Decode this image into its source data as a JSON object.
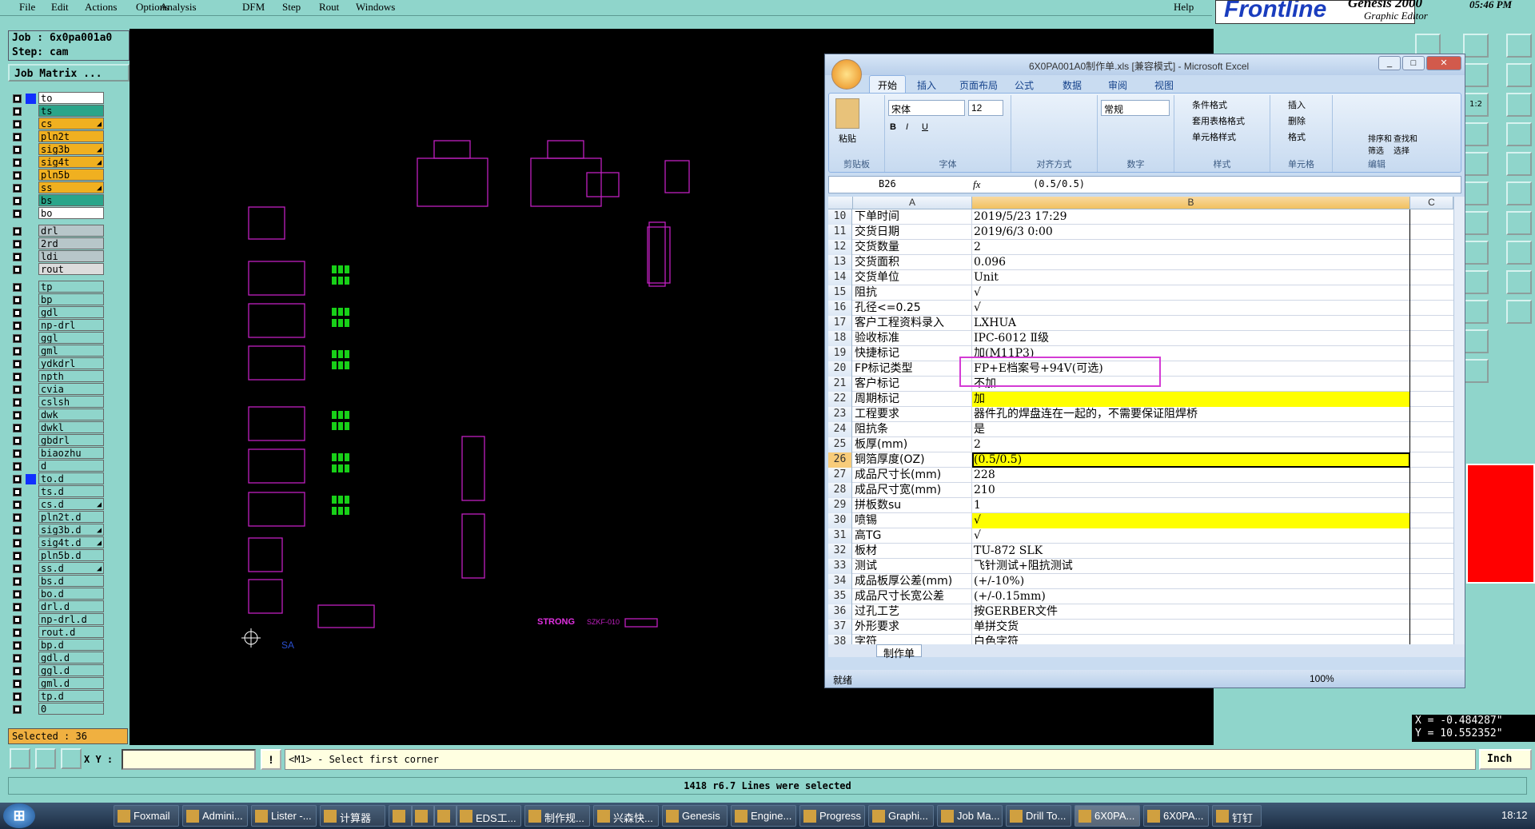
{
  "menu": {
    "items": [
      "File",
      "Edit",
      "Actions",
      "Options",
      "Analysis",
      "DFM",
      "Step",
      "Rout",
      "Windows"
    ],
    "help": "Help"
  },
  "brand": {
    "logo": "Frontline",
    "product": "Genesis 2000",
    "subtitle": "Graphic Editor",
    "time": "05:46 PM"
  },
  "job": {
    "job_line": "Job : 6x0pa001a0",
    "step_line": "Step: cam",
    "matrix_button": "Job Matrix ..."
  },
  "layers": [
    {
      "name": "to",
      "color": "#ffffff",
      "dot": true
    },
    {
      "name": "ts",
      "color": "#2aa58a"
    },
    {
      "name": "cs",
      "color": "#f0b020",
      "flag": true
    },
    {
      "name": "pln2t",
      "color": "#f0b020"
    },
    {
      "name": "sig3b",
      "color": "#f0b020",
      "flag": true
    },
    {
      "name": "sig4t",
      "color": "#f0b020",
      "flag": true
    },
    {
      "name": "pln5b",
      "color": "#f0b020"
    },
    {
      "name": "ss",
      "color": "#f0b020",
      "flag": true
    },
    {
      "name": "bs",
      "color": "#2aa58a"
    },
    {
      "name": "bo",
      "color": "#ffffff"
    },
    {
      "name": "drl",
      "color": "#b7c6c9",
      "gap": true
    },
    {
      "name": "2rd",
      "color": "#b7c6c9"
    },
    {
      "name": "ldi",
      "color": "#b7c6c9"
    },
    {
      "name": "rout",
      "color": "#dcdcdc"
    },
    {
      "name": "tp",
      "color": "#8fd5cb",
      "gap": true
    },
    {
      "name": "bp",
      "color": "#8fd5cb"
    },
    {
      "name": "gdl",
      "color": "#8fd5cb"
    },
    {
      "name": "np-drl",
      "color": "#8fd5cb"
    },
    {
      "name": "ggl",
      "color": "#8fd5cb"
    },
    {
      "name": "gml",
      "color": "#8fd5cb"
    },
    {
      "name": "ydkdrl",
      "color": "#8fd5cb"
    },
    {
      "name": "npth",
      "color": "#8fd5cb"
    },
    {
      "name": "cvia",
      "color": "#8fd5cb"
    },
    {
      "name": "cslsh",
      "color": "#8fd5cb"
    },
    {
      "name": "dwk",
      "color": "#8fd5cb"
    },
    {
      "name": "dwkl",
      "color": "#8fd5cb"
    },
    {
      "name": "gbdrl",
      "color": "#8fd5cb"
    },
    {
      "name": "biaozhu",
      "color": "#8fd5cb"
    },
    {
      "name": "d",
      "color": "#8fd5cb"
    },
    {
      "name": "to.d",
      "color": "#8fd5cb",
      "blue": true
    },
    {
      "name": "ts.d",
      "color": "#8fd5cb"
    },
    {
      "name": "cs.d",
      "color": "#8fd5cb",
      "flag": true
    },
    {
      "name": "pln2t.d",
      "color": "#8fd5cb"
    },
    {
      "name": "sig3b.d",
      "color": "#8fd5cb",
      "flag": true
    },
    {
      "name": "sig4t.d",
      "color": "#8fd5cb",
      "flag": true
    },
    {
      "name": "pln5b.d",
      "color": "#8fd5cb"
    },
    {
      "name": "ss.d",
      "color": "#8fd5cb",
      "flag": true
    },
    {
      "name": "bs.d",
      "color": "#8fd5cb"
    },
    {
      "name": "bo.d",
      "color": "#8fd5cb"
    },
    {
      "name": "drl.d",
      "color": "#8fd5cb"
    },
    {
      "name": "np-drl.d",
      "color": "#8fd5cb"
    },
    {
      "name": "rout.d",
      "color": "#8fd5cb"
    },
    {
      "name": "bp.d",
      "color": "#8fd5cb"
    },
    {
      "name": "gdl.d",
      "color": "#8fd5cb"
    },
    {
      "name": "ggl.d",
      "color": "#8fd5cb"
    },
    {
      "name": "gml.d",
      "color": "#8fd5cb"
    },
    {
      "name": "tp.d",
      "color": "#8fd5cb"
    },
    {
      "name": "0",
      "color": "#8fd5cb"
    }
  ],
  "selected": "Selected : 36",
  "canvas": {
    "label_sa": "SA",
    "label_str": "STRONG",
    "label_szkf": "SZKF-010"
  },
  "coords": {
    "x": "X = -0.484287\"",
    "y": "Y = 10.552352\""
  },
  "rightbar": {
    "scale": "1:2"
  },
  "bottom": {
    "xy_label": "X Y :",
    "xy_value": "",
    "message": "<M1> - Select first corner",
    "unit": "Inch",
    "status": "1418 r6.7 Lines were selected"
  },
  "excel": {
    "title": "6X0PA001A0制作单.xls  [兼容模式] - Microsoft Excel",
    "tabs": [
      "开始",
      "插入",
      "页面布局",
      "公式",
      "数据",
      "审阅",
      "视图"
    ],
    "groups": [
      "剪贴板",
      "字体",
      "对齐方式",
      "数字",
      "样式",
      "单元格",
      "编辑"
    ],
    "paste": "粘贴",
    "font": "宋体",
    "size": "12",
    "numfmt": "常规",
    "styles": [
      "条件格式",
      "套用表格格式",
      "单元格样式"
    ],
    "cells_btns": [
      "插入",
      "删除",
      "格式"
    ],
    "edit_btns": [
      "排序和筛选",
      "查找和选择"
    ],
    "namebox": "B26",
    "fx": "fx",
    "formula": "(0.5/0.5)",
    "cols": [
      "A",
      "B",
      "C"
    ],
    "rows": [
      {
        "n": "10",
        "a": "下单时间",
        "b": "2019/5/23 17:29"
      },
      {
        "n": "11",
        "a": "交货日期",
        "b": "2019/6/3 0:00"
      },
      {
        "n": "12",
        "a": "交货数量",
        "b": "2"
      },
      {
        "n": "13",
        "a": "交货面积",
        "b": "0.096"
      },
      {
        "n": "14",
        "a": "交货单位",
        "b": "Unit"
      },
      {
        "n": "15",
        "a": "阻抗",
        "b": "√"
      },
      {
        "n": "16",
        "a": "孔径<=0.25",
        "b": "√"
      },
      {
        "n": "17",
        "a": "客户工程资料录入",
        "b": "LXHUA"
      },
      {
        "n": "18",
        "a": "验收标准",
        "b": "IPC-6012 Ⅱ级"
      },
      {
        "n": "19",
        "a": "快捷标记",
        "b": "加(M11P3)"
      },
      {
        "n": "20",
        "a": "FP标记类型",
        "b": "FP+E档案号+94V(可选)"
      },
      {
        "n": "21",
        "a": "客户标记",
        "b": "不加"
      },
      {
        "n": "22",
        "a": "周期标记",
        "b": "加",
        "y": true
      },
      {
        "n": "23",
        "a": "工程要求",
        "b": "器件孔的焊盘连在一起的，不需要保证阻焊桥"
      },
      {
        "n": "24",
        "a": "阻抗条",
        "b": "是"
      },
      {
        "n": "25",
        "a": "板厚(mm)",
        "b": "2"
      },
      {
        "n": "26",
        "a": "铜箔厚度(OZ)",
        "b": "(0.5/0.5)",
        "y": true,
        "active": true
      },
      {
        "n": "27",
        "a": "成品尺寸长(mm)",
        "b": "228"
      },
      {
        "n": "28",
        "a": "成品尺寸宽(mm)",
        "b": "210"
      },
      {
        "n": "29",
        "a": "拼板数su",
        "b": "1"
      },
      {
        "n": "30",
        "a": "喷锡",
        "b": "√",
        "y": true
      },
      {
        "n": "31",
        "a": "高TG",
        "b": "√"
      },
      {
        "n": "32",
        "a": "板材",
        "b": "TU-872 SLK"
      },
      {
        "n": "33",
        "a": "测试",
        "b": "飞针测试+阻抗测试"
      },
      {
        "n": "34",
        "a": "成品板厚公差(mm)",
        "b": "(+/-10%)"
      },
      {
        "n": "35",
        "a": "成品尺寸长宽公差",
        "b": "(+/-0.15mm)"
      },
      {
        "n": "36",
        "a": "过孔工艺",
        "b": "按GERBER文件"
      },
      {
        "n": "37",
        "a": "外形要求",
        "b": "单拼交货"
      },
      {
        "n": "38",
        "a": "字符",
        "b": "白色字符"
      }
    ],
    "sheet": "制作单",
    "status": "就绪",
    "zoom": "100%"
  },
  "taskbar": {
    "items": [
      "Foxmail",
      "Admini...",
      "Lister -...",
      "计算器",
      "",
      "",
      "",
      "EDS工...",
      "制作规...",
      "兴森快...",
      "Genesis",
      "Engine...",
      "Progress",
      "Graphi...",
      "Job Ma...",
      "Drill To...",
      "6X0PA...",
      "6X0PA...",
      "钉钉"
    ],
    "time": "18:12"
  }
}
